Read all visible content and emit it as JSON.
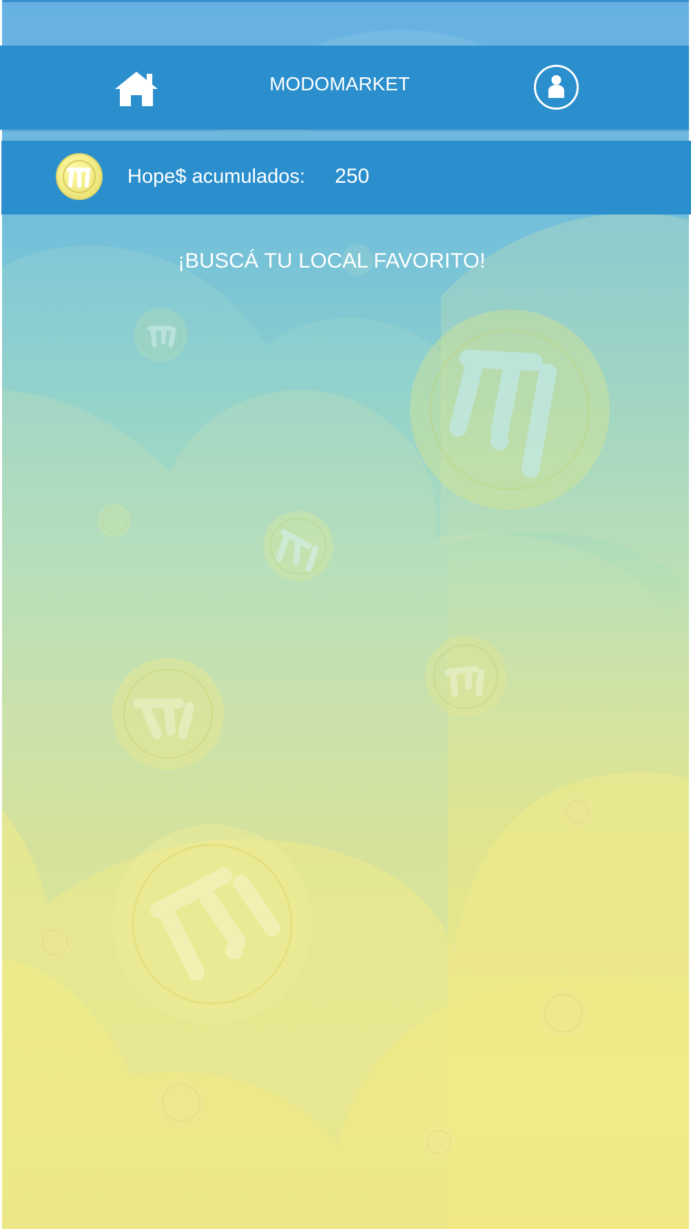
{
  "app": {
    "title": "MODOMARKET"
  },
  "header": {
    "home_icon": "home-icon",
    "profile_icon": "user-profile-icon"
  },
  "points": {
    "label": "Hope$ acumulados:",
    "value": "250",
    "coin_icon": "coin-icon"
  },
  "main": {
    "prompt": "¡BUSCÁ TU LOCAL FAVORITO!"
  },
  "theme": {
    "primary_blue": "#2b8fcd",
    "light_blue": "#66b1e2",
    "yellow": "#f1ea82",
    "coin_gold": "#efe48a"
  }
}
